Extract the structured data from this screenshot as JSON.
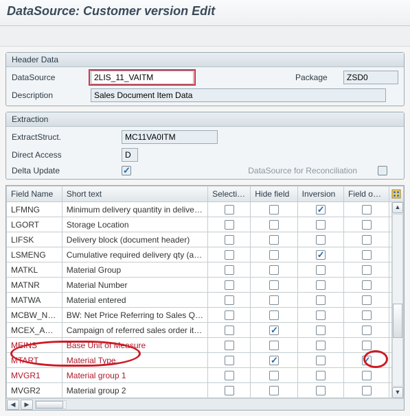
{
  "page": {
    "title": "DataSource: Customer version Edit"
  },
  "header_box": {
    "title": "Header Data",
    "datasource_label": "DataSource",
    "datasource_value": "2LIS_11_VAITM",
    "package_label": "Package",
    "package_value": "ZSD0",
    "description_label": "Description",
    "description_value": "Sales Document Item Data"
  },
  "extraction_box": {
    "title": "Extraction",
    "extract_struct_label": "ExtractStruct.",
    "extract_struct_value": "MC11VA0ITM",
    "direct_access_label": "Direct Access",
    "direct_access_value": "D",
    "delta_update_label": "Delta Update",
    "delta_update_checked": true,
    "reconciliation_label": "DataSource for Reconciliation",
    "reconciliation_checked": false
  },
  "grid": {
    "columns": {
      "field_name": "Field Name",
      "short_text": "Short text",
      "selection": "Selection",
      "hide_field": "Hide field",
      "inversion": "Inversion",
      "field_only": "Field only.."
    },
    "rows": [
      {
        "field": "LFMNG",
        "text": "Minimum delivery quantity in delivery not..",
        "selection": false,
        "hide": false,
        "inversion": true,
        "field_only": false,
        "emph": false
      },
      {
        "field": "LGORT",
        "text": "Storage Location",
        "selection": false,
        "hide": false,
        "inversion": false,
        "field_only": false,
        "emph": false
      },
      {
        "field": "LIFSK",
        "text": "Delivery block (document header)",
        "selection": false,
        "hide": false,
        "inversion": false,
        "field_only": false,
        "emph": false
      },
      {
        "field": "LSMENG",
        "text": "Cumulative required delivery qty (all dlv-r..",
        "selection": false,
        "hide": false,
        "inversion": true,
        "field_only": false,
        "emph": false
      },
      {
        "field": "MATKL",
        "text": "Material Group",
        "selection": false,
        "hide": false,
        "inversion": false,
        "field_only": false,
        "emph": false
      },
      {
        "field": "MATNR",
        "text": "Material Number",
        "selection": false,
        "hide": false,
        "inversion": false,
        "field_only": false,
        "emph": false
      },
      {
        "field": "MATWA",
        "text": "Material entered",
        "selection": false,
        "hide": false,
        "inversion": false,
        "field_only": false,
        "emph": false
      },
      {
        "field": "MCBW_NETP..",
        "text": "BW: Net Price Referring to Sales Quantit..",
        "selection": false,
        "hide": false,
        "inversion": false,
        "field_only": false,
        "emph": false
      },
      {
        "field": "MCEX_APCA..",
        "text": "Campaign of referred sales order item fo..",
        "selection": false,
        "hide": true,
        "inversion": false,
        "field_only": false,
        "emph": false
      },
      {
        "field": "MEINS",
        "text": "Base Unit of Measure",
        "selection": false,
        "hide": false,
        "inversion": false,
        "field_only": false,
        "emph": true
      },
      {
        "field": "MTART",
        "text": "Material Type",
        "selection": false,
        "hide": true,
        "inversion": false,
        "field_only": true,
        "emph": true
      },
      {
        "field": "MVGR1",
        "text": "Material group 1",
        "selection": false,
        "hide": false,
        "inversion": false,
        "field_only": false,
        "emph": true
      },
      {
        "field": "MVGR2",
        "text": "Material group 2",
        "selection": false,
        "hide": false,
        "inversion": false,
        "field_only": false,
        "emph": false
      }
    ]
  }
}
